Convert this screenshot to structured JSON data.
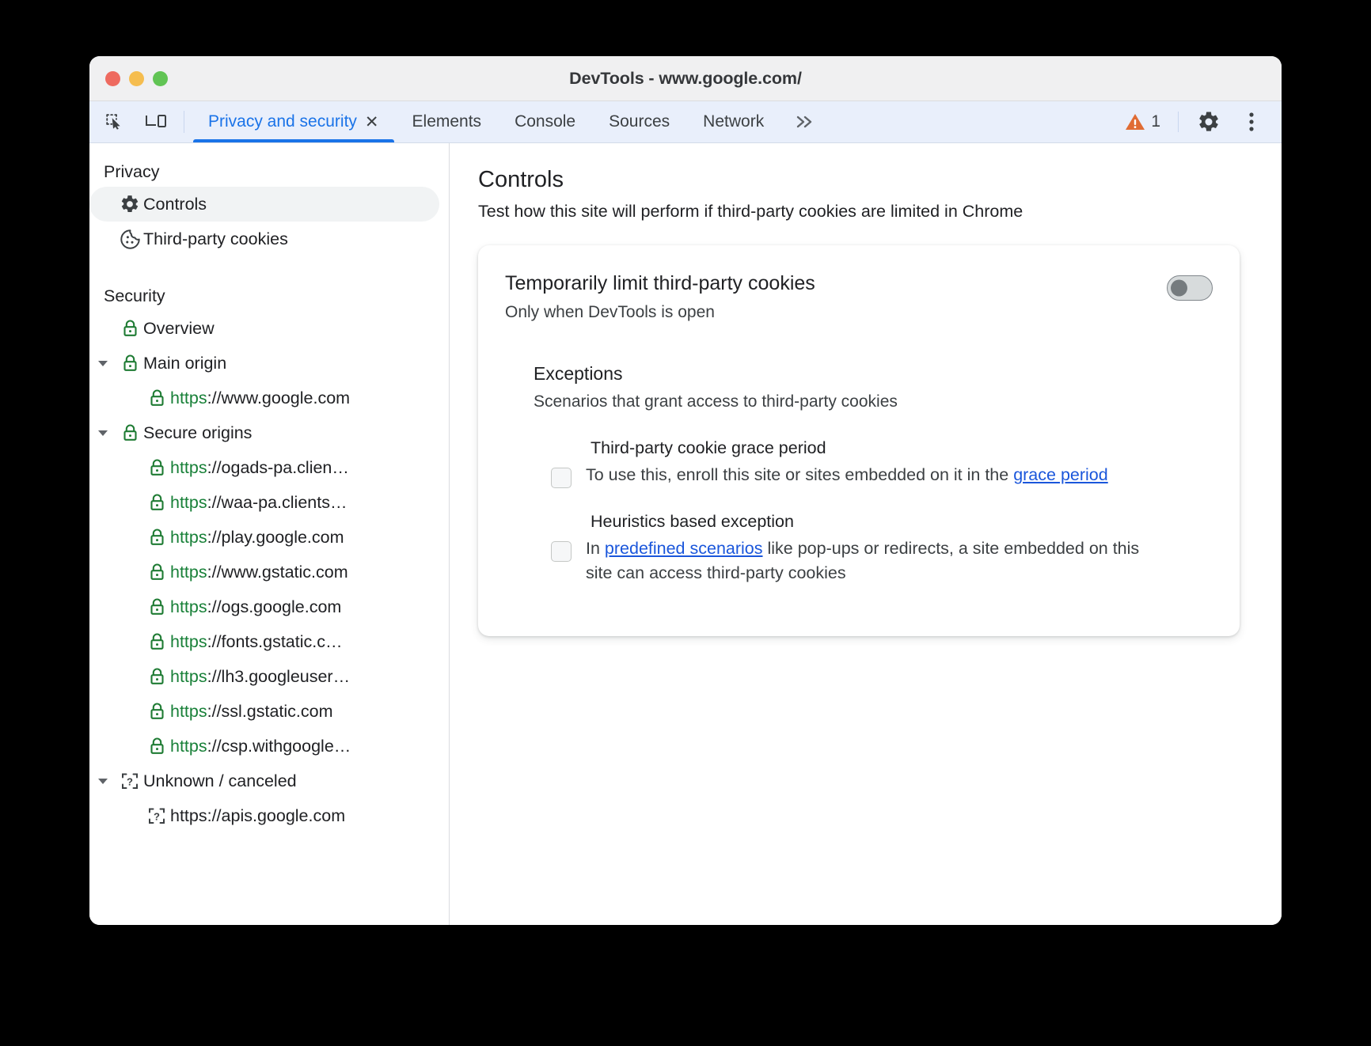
{
  "window": {
    "title": "DevTools - www.google.com/",
    "traffic_lights": [
      "close",
      "minimize",
      "maximize"
    ]
  },
  "tabbar": {
    "inspect_icon": "inspect-element-icon",
    "device_icon": "device-toolbar-icon",
    "tabs": [
      {
        "label": "Privacy and security",
        "active": true,
        "closable": true,
        "close_label": "✕"
      },
      {
        "label": "Elements",
        "active": false,
        "closable": false
      },
      {
        "label": "Console",
        "active": false,
        "closable": false
      },
      {
        "label": "Sources",
        "active": false,
        "closable": false
      },
      {
        "label": "Network",
        "active": false,
        "closable": false
      }
    ],
    "more_tabs_label": "»",
    "warning_count": "1",
    "warning_color": "#e06c34",
    "settings_icon": "gear-icon",
    "menu_icon": "kebab-menu-icon",
    "accent_color": "#1a73e8",
    "background_color": "#e9effb"
  },
  "sidebar": {
    "sections": [
      {
        "title": "Privacy",
        "items": [
          {
            "icon": "gear-icon",
            "label": "Controls",
            "indent": 1,
            "selected": true,
            "twisty": false
          },
          {
            "icon": "cookie-icon",
            "label": "Third-party cookies",
            "indent": 1,
            "selected": false,
            "twisty": false
          }
        ]
      },
      {
        "title": "Security",
        "items": [
          {
            "icon": "lock-icon",
            "label": "Overview",
            "indent": 1,
            "selected": false,
            "twisty": false
          },
          {
            "icon": "lock-icon",
            "label": "Main origin",
            "indent": 0,
            "selected": false,
            "twisty": true
          },
          {
            "icon": "lock-icon",
            "scheme": "https",
            "rest": "://www.google.com",
            "indent": 1,
            "selected": false,
            "twisty": false,
            "is_url": true
          },
          {
            "icon": "lock-icon",
            "label": "Secure origins",
            "indent": 0,
            "selected": false,
            "twisty": true
          },
          {
            "icon": "lock-icon",
            "scheme": "https",
            "rest": "://ogads-pa.clien…",
            "indent": 1,
            "selected": false,
            "twisty": false,
            "is_url": true
          },
          {
            "icon": "lock-icon",
            "scheme": "https",
            "rest": "://waa-pa.clients…",
            "indent": 1,
            "selected": false,
            "twisty": false,
            "is_url": true
          },
          {
            "icon": "lock-icon",
            "scheme": "https",
            "rest": "://play.google.com",
            "indent": 1,
            "selected": false,
            "twisty": false,
            "is_url": true
          },
          {
            "icon": "lock-icon",
            "scheme": "https",
            "rest": "://www.gstatic.com",
            "indent": 1,
            "selected": false,
            "twisty": false,
            "is_url": true
          },
          {
            "icon": "lock-icon",
            "scheme": "https",
            "rest": "://ogs.google.com",
            "indent": 1,
            "selected": false,
            "twisty": false,
            "is_url": true
          },
          {
            "icon": "lock-icon",
            "scheme": "https",
            "rest": "://fonts.gstatic.c…",
            "indent": 1,
            "selected": false,
            "twisty": false,
            "is_url": true
          },
          {
            "icon": "lock-icon",
            "scheme": "https",
            "rest": "://lh3.googleuser…",
            "indent": 1,
            "selected": false,
            "twisty": false,
            "is_url": true
          },
          {
            "icon": "lock-icon",
            "scheme": "https",
            "rest": "://ssl.gstatic.com",
            "indent": 1,
            "selected": false,
            "twisty": false,
            "is_url": true
          },
          {
            "icon": "lock-icon",
            "scheme": "https",
            "rest": "://csp.withgoogle…",
            "indent": 1,
            "selected": false,
            "twisty": false,
            "is_url": true
          },
          {
            "icon": "unknown-icon",
            "label": "Unknown / canceled",
            "indent": 0,
            "selected": false,
            "twisty": true
          },
          {
            "icon": "unknown-icon",
            "label": "https://apis.google.com",
            "indent": 1,
            "selected": false,
            "twisty": false
          }
        ]
      }
    ],
    "lock_color": "#1e7b33",
    "selected_bg": "#f1f3f4"
  },
  "main": {
    "title": "Controls",
    "subtitle": "Test how this site will perform if third-party cookies are limited in Chrome",
    "card": {
      "title": "Temporarily limit third-party cookies",
      "subtitle": "Only when DevTools is open",
      "toggle": {
        "name": "limit-third-party-cookies-toggle",
        "checked": false
      },
      "exceptions": {
        "title": "Exceptions",
        "subtitle": "Scenarios that grant access to third-party cookies",
        "items": [
          {
            "title": "Third-party cookie grace period",
            "checked": false,
            "desc_before": "To use this, enroll this site or sites embedded on it in the ",
            "link": "grace period",
            "desc_after": ""
          },
          {
            "title": "Heuristics based exception",
            "checked": false,
            "desc_before": "In ",
            "link": "predefined scenarios",
            "desc_after": " like pop-ups or redirects, a site embedded on this site can access third-party cookies"
          }
        ],
        "link_color": "#1a56db"
      }
    }
  }
}
